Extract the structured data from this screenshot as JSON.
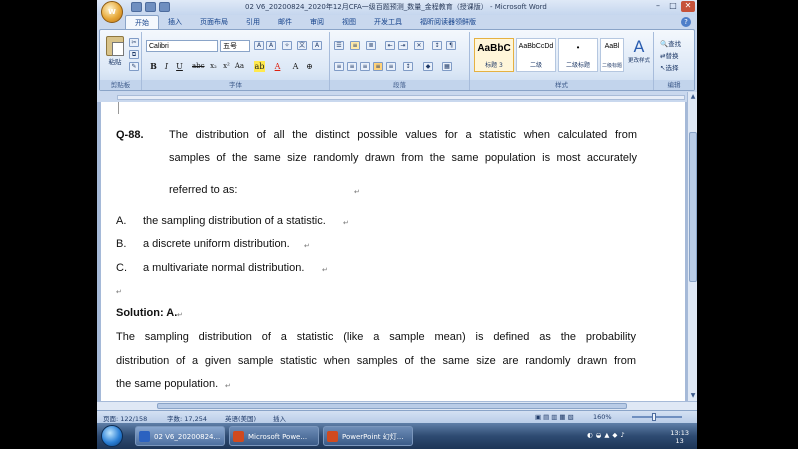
{
  "window": {
    "title": "02 V6_20200824_2020年12月CFA一级百题预测_数量_金程教育（授课版） - Microsoft Word",
    "office_button_label": "W"
  },
  "tabs": [
    "开始",
    "插入",
    "页面布局",
    "引用",
    "邮件",
    "审阅",
    "视图",
    "开发工具",
    "福昕阅读器领鲜版"
  ],
  "ribbon": {
    "clipboard": {
      "paste": "粘贴",
      "label": "剪贴板"
    },
    "font": {
      "name": "Calibri",
      "size": "五号",
      "label": "字体"
    },
    "paragraph": {
      "label": "段落"
    },
    "styles": {
      "label": "样式",
      "items": [
        {
          "sample": "AaBbC",
          "name": "标题 3"
        },
        {
          "sample": "AaBbCcDd",
          "name": "二级"
        },
        {
          "sample": "•",
          "name": "二级标题"
        },
        {
          "sample": "AaBl",
          "name": "二级标题"
        }
      ],
      "change_styles": "更改样式"
    },
    "editing": {
      "label": "编辑",
      "find": "查找",
      "replace": "替换",
      "select": "选择"
    }
  },
  "document": {
    "question_number": "Q-88.",
    "question_lines": [
      "The distribution of all the distinct possible values for a statistic when calculated from",
      "samples of the same size randomly drawn from the same population is most accurately",
      "referred to as:"
    ],
    "options": [
      {
        "letter": "A.",
        "text": "the sampling distribution of a statistic."
      },
      {
        "letter": "B.",
        "text": "a discrete uniform distribution."
      },
      {
        "letter": "C.",
        "text": "a multivariate normal distribution."
      }
    ],
    "solution_title": "Solution: A.",
    "solution_lines": [
      "The sampling distribution of a statistic (like a sample mean) is defined as the probability",
      "distribution of a given sample statistic when samples of the same size are randomly drawn from",
      "the same population."
    ],
    "para_mark": "↵"
  },
  "status": {
    "page": "页面: 122/158",
    "words": "字数: 17,254",
    "language": "英语(美国)",
    "insert": "插入",
    "zoom": "160%"
  },
  "taskbar": {
    "tasks": [
      "02 V6_20200824...",
      "Microsoft Powe...",
      "PowerPoint 幻灯..."
    ],
    "time": "13:13",
    "date": "13"
  }
}
